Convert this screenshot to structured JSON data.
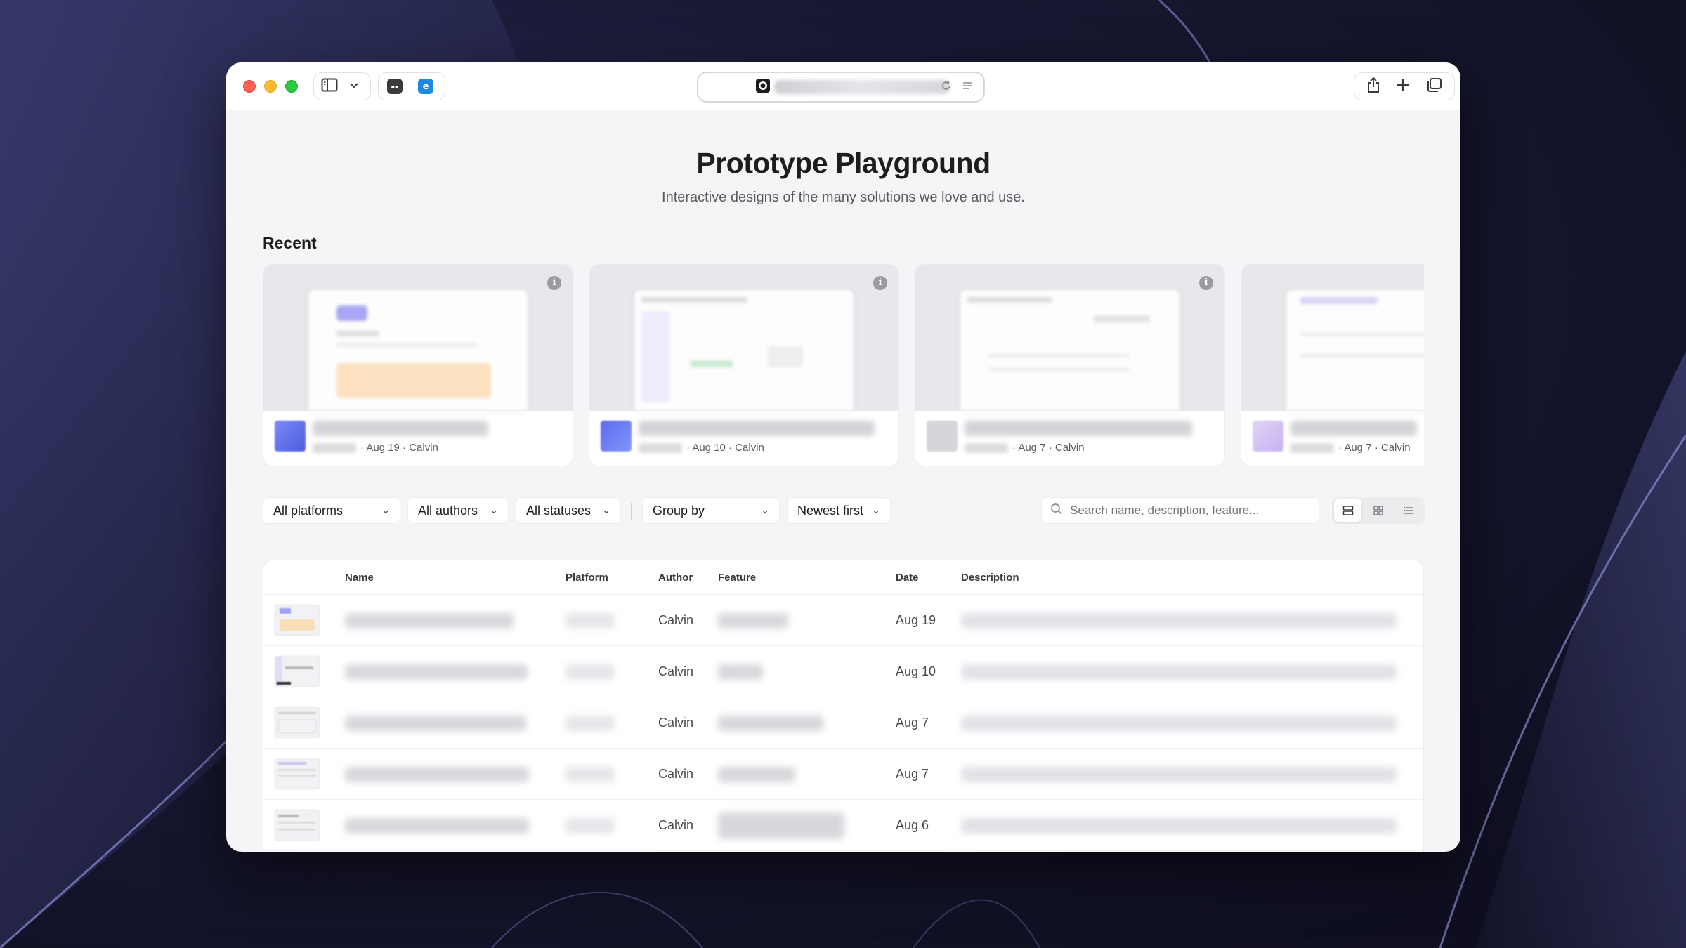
{
  "browser": {
    "favicons": [
      "dark-tab",
      "blue-tab"
    ]
  },
  "page": {
    "title": "Prototype Playground",
    "subtitle": "Interactive designs of the many solutions we love and use."
  },
  "recent": {
    "heading": "Recent",
    "cards": [
      {
        "meta": "· Aug 19 · Calvin",
        "avatar_color": "#6c7df0"
      },
      {
        "meta": "· Aug 10 · Calvin",
        "avatar_color": "#5a6fe8"
      },
      {
        "meta": "· Aug 7 · Calvin",
        "avatar_color": "#c8c8cc"
      },
      {
        "meta": "· Aug 7 · Calvin",
        "avatar_color": "#d7c8f3"
      }
    ]
  },
  "filters": {
    "platforms": "All platforms",
    "authors": "All authors",
    "statuses": "All statuses",
    "group_by": "Group by",
    "sort": "Newest first",
    "search_placeholder": "Search name, description, feature..."
  },
  "table": {
    "columns": {
      "name": "Name",
      "platform": "Platform",
      "author": "Author",
      "feature": "Feature",
      "date": "Date",
      "description": "Description"
    },
    "rows": [
      {
        "author": "Calvin",
        "date": "Aug 19"
      },
      {
        "author": "Calvin",
        "date": "Aug 10"
      },
      {
        "author": "Calvin",
        "date": "Aug 7"
      },
      {
        "author": "Calvin",
        "date": "Aug 7"
      },
      {
        "author": "Calvin",
        "date": "Aug 6"
      }
    ]
  },
  "colors": {
    "traffic_red": "#ff5f57",
    "traffic_yellow": "#febc2e",
    "traffic_green": "#28c840"
  }
}
